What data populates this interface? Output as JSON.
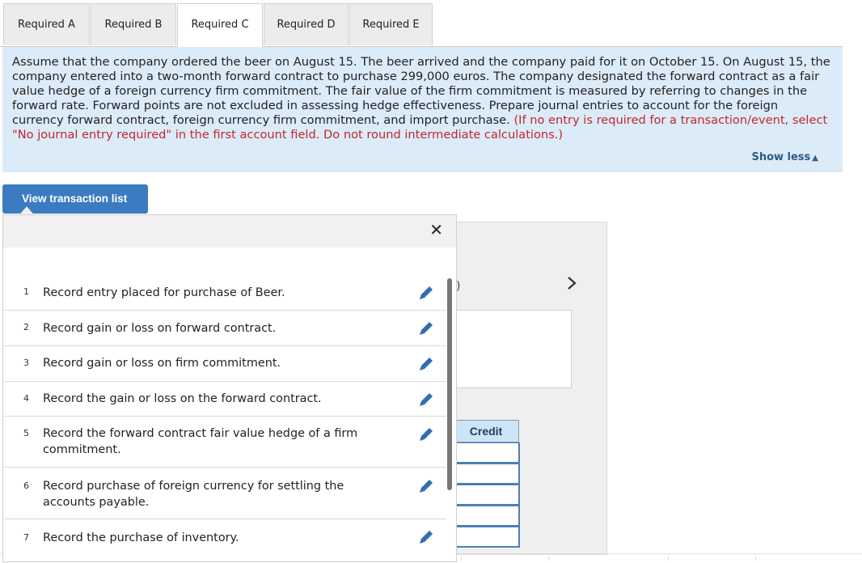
{
  "tabs": [
    {
      "label": "Required A",
      "active": false
    },
    {
      "label": "Required B",
      "active": false
    },
    {
      "label": "Required C",
      "active": true
    },
    {
      "label": "Required D",
      "active": false
    },
    {
      "label": "Required E",
      "active": false
    }
  ],
  "instructions": {
    "text": "Assume that the company ordered the beer on August 15. The beer arrived and the company paid for it on October 15. On August 15, the company entered into a two-month forward contract to purchase 299,000 euros. The company designated the forward contract as a fair value hedge of a foreign currency firm commitment. The fair value of the firm commitment is measured by referring to changes in the forward rate. Forward points are not excluded in assessing hedge effectiveness. Prepare journal entries to account for the foreign currency forward contract, foreign currency firm commitment, and import purchase.",
    "note": "(If no entry is required for a transaction/event, select \"No journal entry required\" in the first account field. Do not round intermediate calculations.)",
    "show_less_label": "Show less"
  },
  "view_transaction_button": "View transaction list",
  "worksheet": {
    "credit_header": "Credit"
  },
  "transactions": [
    {
      "num": "1",
      "text": "Record entry placed for purchase of Beer."
    },
    {
      "num": "2",
      "text": "Record gain or loss on forward contract."
    },
    {
      "num": "3",
      "text": "Record gain or loss on firm commitment."
    },
    {
      "num": "4",
      "text": "Record the gain or loss on the forward contract."
    },
    {
      "num": "5",
      "text": "Record the forward contract fair value hedge of a firm commitment."
    },
    {
      "num": "6",
      "text": "Record purchase of foreign currency for settling the accounts payable."
    },
    {
      "num": "7",
      "text": "Record the purchase of inventory."
    }
  ],
  "colors": {
    "accent": "#3b7bc1",
    "instruction_bg": "#dcebf8",
    "note_red": "#c0282d",
    "pencil": "#2f6fb3"
  },
  "icons": {
    "close": "close-icon",
    "edit": "pencil-icon",
    "next": "chevron-right-icon",
    "show_less": "triangle-up-icon"
  }
}
